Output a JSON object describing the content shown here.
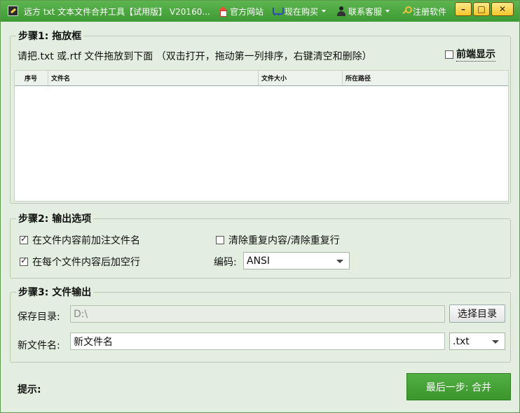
{
  "titlebar": {
    "title": "远方 txt 文本文件合并工具【试用版】 V20160...",
    "links": {
      "website": "官方网站",
      "buy": "现在购买",
      "contact": "联系客服",
      "register": "注册软件"
    },
    "buttons": {
      "minimize": "–",
      "maximize": "□",
      "close": "✕"
    }
  },
  "step1": {
    "title": "步骤1: 拖放框",
    "hint": "请把.txt 或.rtf 文件拖放到下面 （双击打开，拖动第一列排序，右键清空和删除）",
    "topmost_label": "前端显示",
    "topmost_checked": false,
    "columns": [
      "序号",
      "文件名",
      "文件大小",
      "所在路径"
    ],
    "rows": []
  },
  "step2": {
    "title": "步骤2: 输出选项",
    "opt_add_filename": "在文件内容前加注文件名",
    "opt_add_filename_checked": true,
    "opt_add_blankline": "在每个文件内容后加空行",
    "opt_add_blankline_checked": true,
    "opt_remove_dup": "清除重复内容/清除重复行",
    "opt_remove_dup_checked": false,
    "encoding_label": "编码:",
    "encoding_value": "ANSI"
  },
  "step3": {
    "title": "步骤3: 文件输出",
    "save_dir_label": "保存目录:",
    "save_dir_value": "D:\\",
    "choose_dir_button": "选择目录",
    "new_name_label": "新文件名:",
    "new_name_value": "新文件名",
    "ext_value": ".txt"
  },
  "footer": {
    "hint_label": "提示:",
    "merge_button": "最后一步: 合并"
  }
}
